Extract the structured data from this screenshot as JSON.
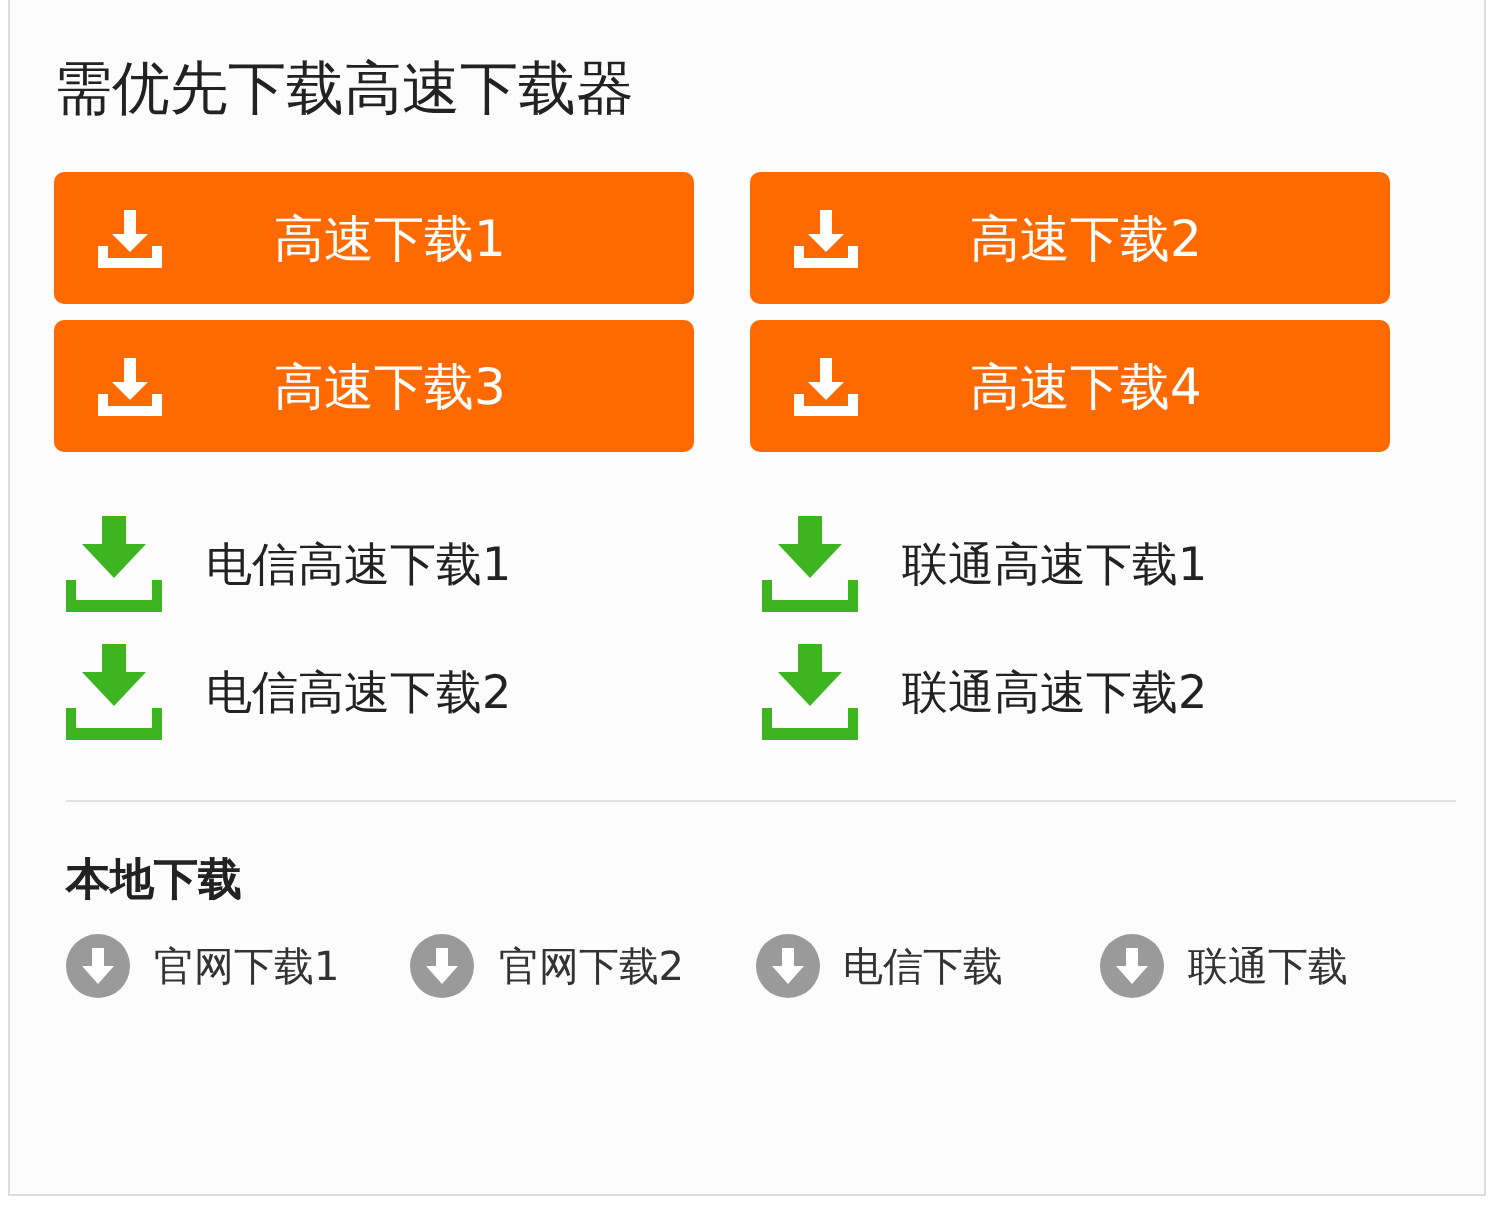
{
  "title": "需优先下载高速下载器",
  "fast_buttons": [
    {
      "label": "高速下载1"
    },
    {
      "label": "高速下载2"
    },
    {
      "label": "高速下载3"
    },
    {
      "label": "高速下载4"
    }
  ],
  "carrier_links": [
    {
      "label": "电信高速下载1"
    },
    {
      "label": "联通高速下载1"
    },
    {
      "label": "电信高速下载2"
    },
    {
      "label": "联通高速下载2"
    }
  ],
  "local": {
    "heading": "本地下载",
    "links": [
      {
        "label": "官网下载1"
      },
      {
        "label": "官网下载2"
      },
      {
        "label": "电信下载"
      },
      {
        "label": "联通下载"
      }
    ]
  }
}
